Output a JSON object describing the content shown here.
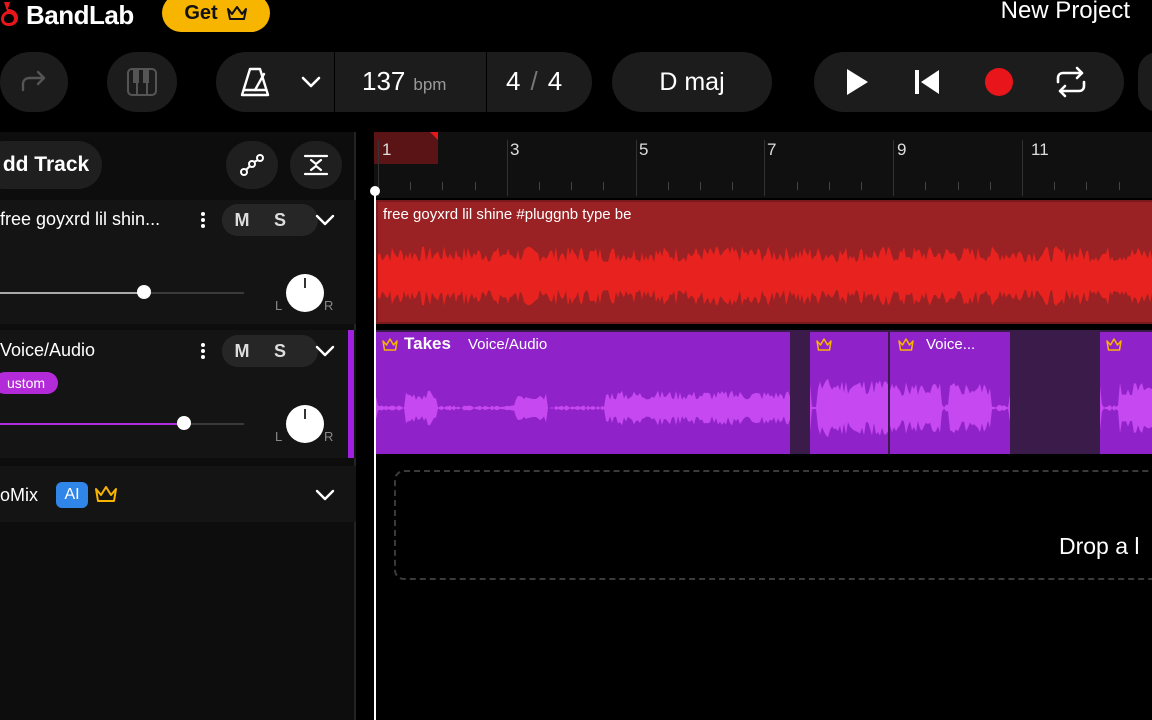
{
  "brand": {
    "name": "BandLab",
    "get_label": "Get"
  },
  "project": {
    "title": "New Project"
  },
  "toolbar": {
    "bpm_value": "137",
    "bpm_unit": "bpm",
    "time_sig_top": "4",
    "time_sig_sep": "/",
    "time_sig_bottom": "4",
    "key": "D maj"
  },
  "left_panel": {
    "add_track_label": "dd Track"
  },
  "tracks": [
    {
      "name": "free goyxrd  lil shin...",
      "mute_label": "M",
      "solo_label": "S",
      "pan_left": "L",
      "pan_right": "R",
      "volume_fraction": 0.59,
      "color": "#e62a2a"
    },
    {
      "name": "Voice/Audio",
      "badge": "ustom",
      "mute_label": "M",
      "solo_label": "S",
      "pan_left": "L",
      "pan_right": "R",
      "volume_fraction": 0.75,
      "color": "#b12de3"
    }
  ],
  "automix": {
    "label": "oMix",
    "ai_badge": "AI"
  },
  "ruler": {
    "bars": [
      "1",
      "3",
      "5",
      "7",
      "9",
      "11"
    ]
  },
  "clips": {
    "track1_label": "free goyxrd  lil shine  #pluggnb type be",
    "track2_takes_label": "Takes",
    "track2_label": "Voice/Audio",
    "track2_clip3_label": "Voice..."
  },
  "drop_zone": {
    "text": "Drop a l"
  },
  "colors": {
    "accent_yellow": "#f7b500",
    "record_red": "#e8161b",
    "track_red": "#e62a2a",
    "track_purple": "#9d26d6",
    "ai_blue": "#2f86e8"
  }
}
